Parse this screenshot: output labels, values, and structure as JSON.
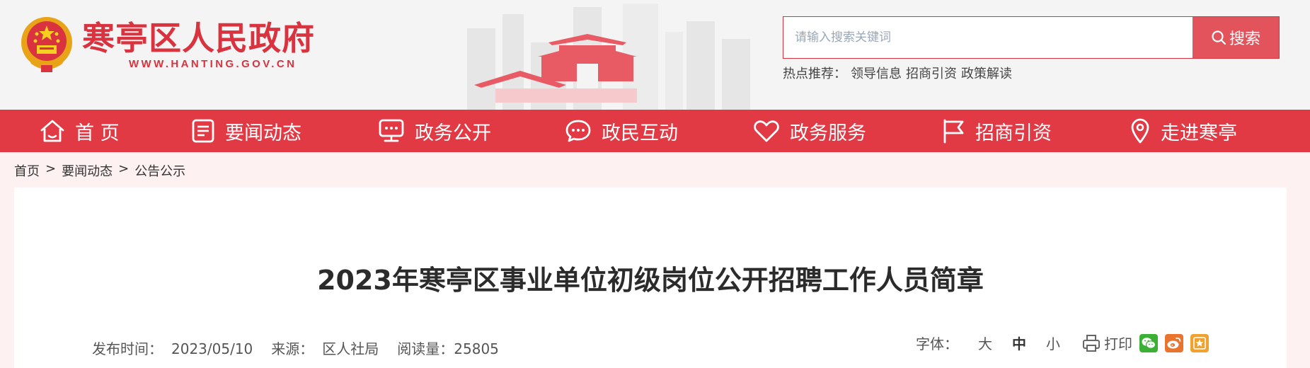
{
  "site": {
    "title": "寒亭区人民政府",
    "url": "WWW.HANTING.GOV.CN"
  },
  "search": {
    "placeholder": "请输入搜索关键词",
    "button_label": "搜索"
  },
  "hot": {
    "label": "热点推荐：",
    "links": [
      "领导信息",
      "招商引资",
      "政策解读"
    ]
  },
  "nav": [
    {
      "label": "首 页",
      "icon": "home-icon"
    },
    {
      "label": "要闻动态",
      "icon": "news-icon"
    },
    {
      "label": "政务公开",
      "icon": "screen-icon"
    },
    {
      "label": "政民互动",
      "icon": "chat-icon"
    },
    {
      "label": "政务服务",
      "icon": "heart-icon"
    },
    {
      "label": "招商引资",
      "icon": "flag-icon"
    },
    {
      "label": "走进寒亭",
      "icon": "location-icon"
    }
  ],
  "breadcrumb": {
    "items": [
      "首页",
      "要闻动态",
      "公告公示"
    ],
    "separator": ">"
  },
  "article": {
    "title": "2023年寒亭区事业单位初级岗位公开招聘工作人员简章",
    "publish_label": "发布时间：",
    "publish_date": "2023/05/10",
    "source_label": "来源：",
    "source": "区人社局",
    "views_label": "阅读量：",
    "views": "25805"
  },
  "tools": {
    "font_label": "字体：",
    "large": "大",
    "medium": "中",
    "small": "小",
    "print": "打印"
  },
  "colors": {
    "brand_red": "#e23a45",
    "wechat": "#3cb034",
    "weibo": "#e8742e",
    "favorite": "#f0a22e"
  }
}
